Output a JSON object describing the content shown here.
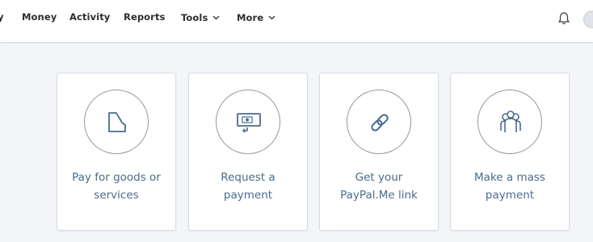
{
  "nav": {
    "items": [
      {
        "label": "Money"
      },
      {
        "label": "Activity"
      },
      {
        "label": "Reports"
      },
      {
        "label": "Tools",
        "chevron": true
      },
      {
        "label": "More",
        "chevron": true
      }
    ],
    "partial_left_label": "y"
  },
  "header_icons": [
    "bell-icon",
    "avatar"
  ],
  "cards": [
    {
      "label": "Pay for goods or\nservices",
      "icon": "receipt-icon"
    },
    {
      "label": "Request a\npayment",
      "icon": "invoice-request-icon"
    },
    {
      "label": "Get your\nPayPal.Me link",
      "icon": "link-icon"
    },
    {
      "label": "Make a mass\npayment",
      "icon": "group-icon"
    }
  ],
  "colors": {
    "background": "#f3f5f8",
    "card_text": "#4a6b8f",
    "icon_stroke": "#4a6b8f",
    "nav_text": "#2c2e2f"
  }
}
